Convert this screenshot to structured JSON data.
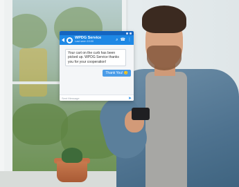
{
  "chat": {
    "contact_name": "WPDG Service",
    "contact_status": "Last seen 10:00",
    "messages": [
      {
        "direction": "incoming",
        "text": "Your cart on the curb has been picked up. WPDG Service thanks you for your cooperation!"
      },
      {
        "direction": "outgoing",
        "text": "Thank You! 🙂"
      }
    ],
    "composer_placeholder": "Sent Message",
    "icons": {
      "back": "back-arrow-icon",
      "avatar": "avatar",
      "search": "search-icon",
      "call": "phone-icon",
      "menu": "more-vert-icon",
      "send": "send-icon"
    },
    "colors": {
      "header": "#1e88e5",
      "status_bar": "#1565c0",
      "outgoing_bubble": "#4a9ce8",
      "incoming_bubble": "#ffffff"
    }
  }
}
